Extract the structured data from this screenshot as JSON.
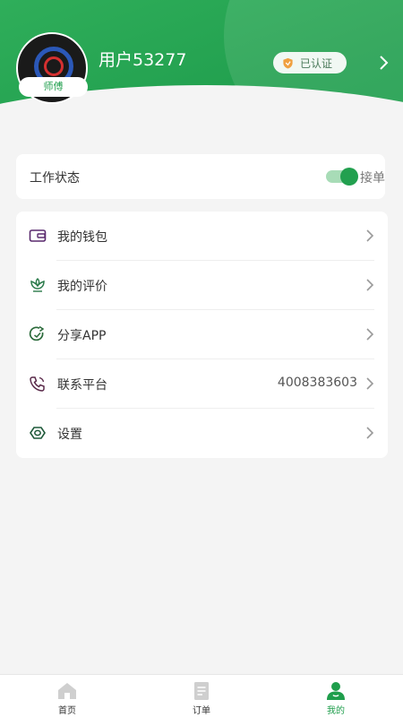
{
  "profile": {
    "role_badge": "师傅",
    "username": "用户53277",
    "verified_label": "已认证"
  },
  "work_status": {
    "label": "工作状态",
    "status": "接单",
    "toggle_on": true
  },
  "menu": {
    "items": [
      {
        "label": "我的钱包",
        "icon": "wallet-icon"
      },
      {
        "label": "我的评价",
        "icon": "review-icon"
      },
      {
        "label": "分享APP",
        "icon": "share-icon"
      },
      {
        "label": "联系平台",
        "icon": "phone-icon",
        "value": "4008383603"
      },
      {
        "label": "设置",
        "icon": "settings-icon"
      }
    ]
  },
  "tabbar": {
    "items": [
      {
        "label": "首页",
        "icon": "home-icon",
        "active": false
      },
      {
        "label": "订单",
        "icon": "order-icon",
        "active": false
      },
      {
        "label": "我的",
        "icon": "profile-icon",
        "active": true
      }
    ]
  },
  "colors": {
    "brand_green": "#22a04f",
    "toggle_track": "#a8dcb7",
    "badge_orange": "#f0a040"
  }
}
